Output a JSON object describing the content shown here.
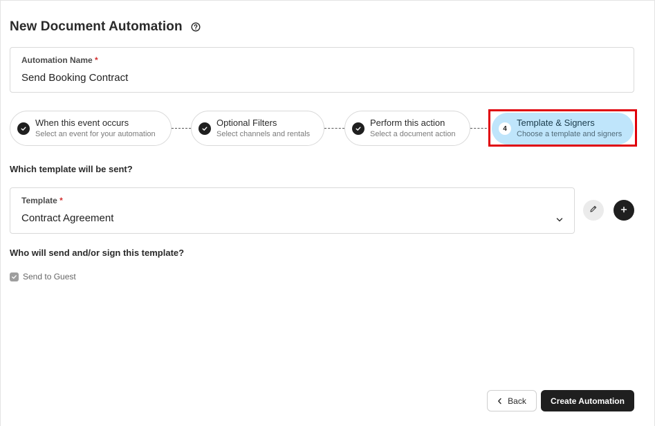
{
  "page": {
    "title": "New Document Automation",
    "help_icon": "question-circle-icon"
  },
  "automation_name": {
    "label": "Automation Name",
    "required_mark": "*",
    "value": "Send Booking Contract"
  },
  "stepper": {
    "steps": [
      {
        "title": "When this event occurs",
        "subtitle": "Select an event for your automation",
        "state": "done"
      },
      {
        "title": "Optional Filters",
        "subtitle": "Select channels and rentals",
        "state": "done"
      },
      {
        "title": "Perform this action",
        "subtitle": "Select a document action",
        "state": "done"
      },
      {
        "number": "4",
        "title": "Template & Signers",
        "subtitle": "Choose a template and signers",
        "state": "active"
      }
    ],
    "active_color": "#bfe5fb",
    "highlight_color": "#e0000a"
  },
  "template_section": {
    "heading": "Which template will be sent?",
    "label": "Template",
    "required_mark": "*",
    "selected": "Contract Agreement",
    "edit_icon": "pencil-icon",
    "add_icon": "plus-icon"
  },
  "signers_section": {
    "heading": "Who will send and/or sign this template?",
    "checkbox_label": "Send to Guest",
    "checkbox_checked": true
  },
  "footer": {
    "back_label": "Back",
    "create_label": "Create Automation"
  }
}
